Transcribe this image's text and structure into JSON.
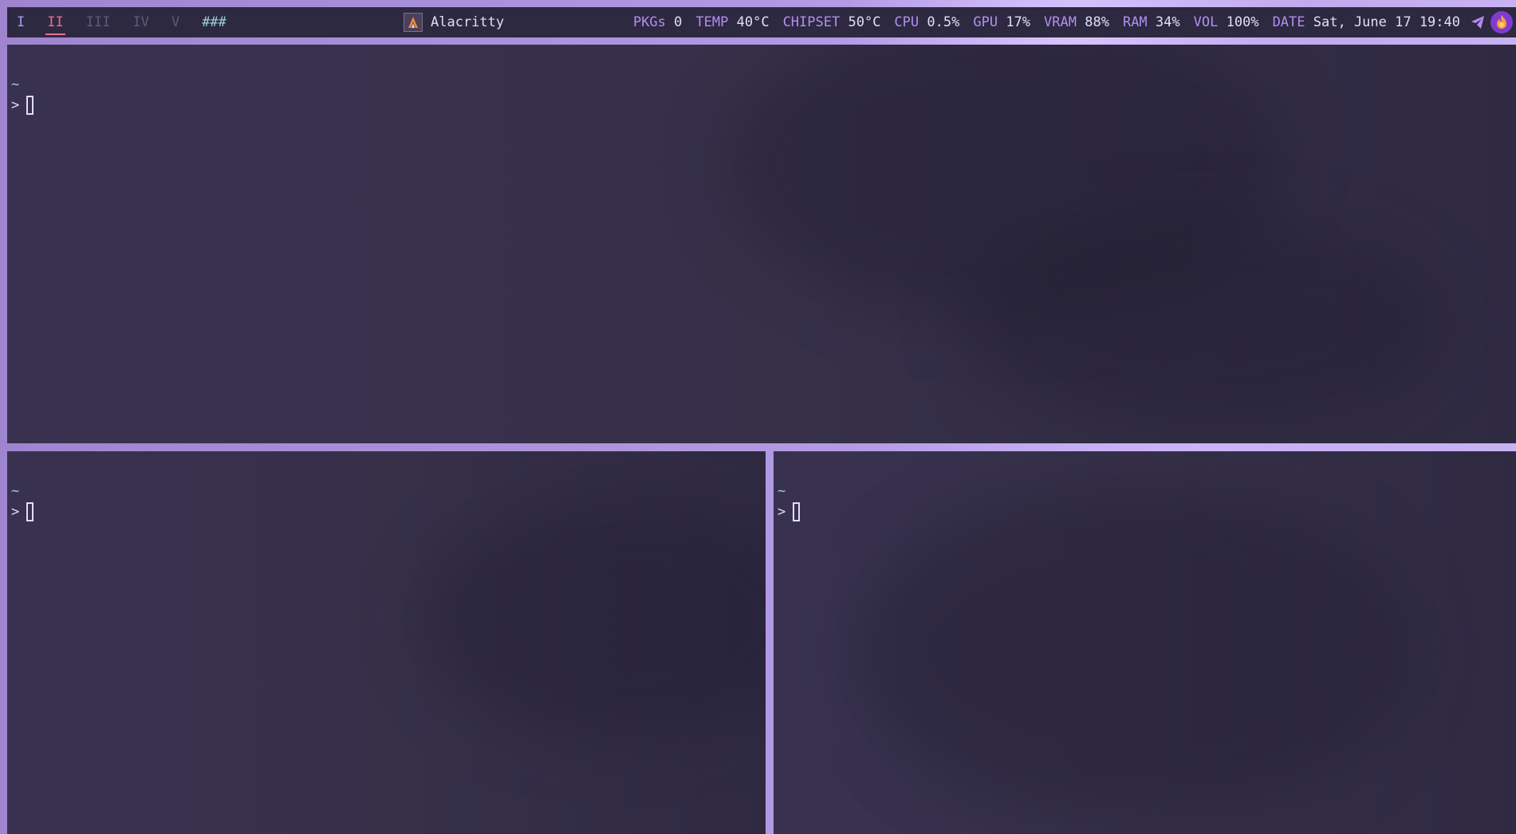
{
  "bar": {
    "workspaces": [
      {
        "label": "I",
        "state": "first"
      },
      {
        "label": "II",
        "state": "active"
      },
      {
        "label": "III",
        "state": "dim"
      },
      {
        "label": "IV",
        "state": "dim"
      },
      {
        "label": "V",
        "state": "dim"
      }
    ],
    "layout_label": "###",
    "window_title": "Alacritty",
    "app_icon": "alacritty-icon",
    "stats": [
      {
        "key": "PKGs",
        "value": "0"
      },
      {
        "key": "TEMP",
        "value": "40°C"
      },
      {
        "key": "CHIPSET",
        "value": "50°C"
      },
      {
        "key": "CPU",
        "value": "0.5%"
      },
      {
        "key": "GPU",
        "value": "17%"
      },
      {
        "key": "VRAM",
        "value": "88%"
      },
      {
        "key": "RAM",
        "value": "34%"
      },
      {
        "key": "VOL",
        "value": "100%"
      },
      {
        "key": "DATE",
        "value": "Sat, June 17 19:40"
      }
    ],
    "tray": [
      "telegram-icon",
      "firefox-icon"
    ]
  },
  "terminals": {
    "top": {
      "dir": "~",
      "prompt": ">"
    },
    "bottom_left": {
      "dir": "~",
      "prompt": ">"
    },
    "bottom_right": {
      "dir": "~",
      "prompt": ">"
    }
  },
  "colors": {
    "bar_bg": "#2d2940",
    "active_ws": "#eb6f92",
    "stat_key": "#b48ef0",
    "terminal_bg": "#363049",
    "border": "#a98fd6"
  }
}
